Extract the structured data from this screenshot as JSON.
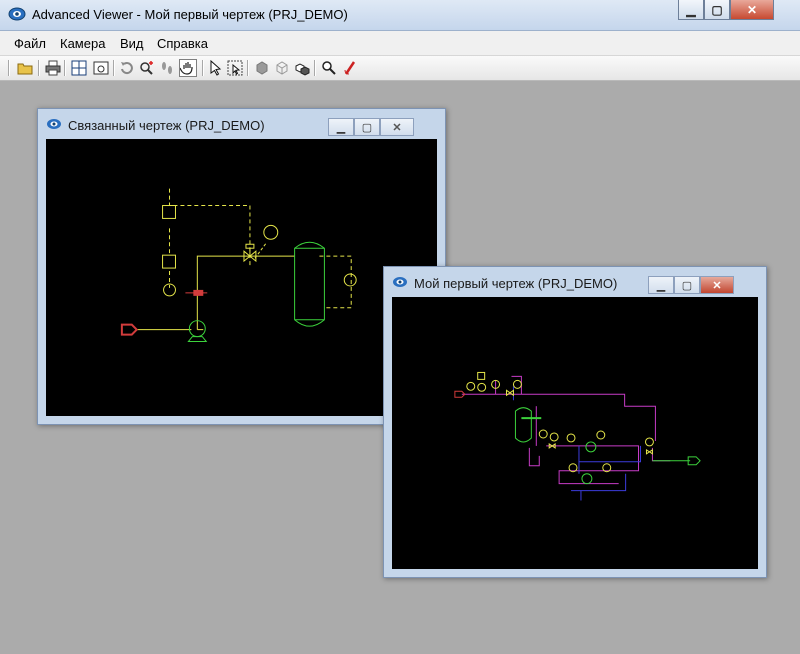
{
  "app": {
    "title": "Advanced Viewer - Мой первый чертеж (PRJ_DEMO)",
    "icon": "advanced-viewer-eye-icon"
  },
  "caption_buttons": {
    "minimize": "▁",
    "maximize": "▢",
    "close": "✕"
  },
  "menu": [
    "Файл",
    "Камера",
    "Вид",
    "Справка"
  ],
  "toolbar": [
    {
      "name": "open-folder-icon"
    },
    {
      "name": "print-icon"
    },
    {
      "name": "layout-grid-icon"
    },
    {
      "name": "preview-icon"
    },
    {
      "name": "rotate-icon"
    },
    {
      "name": "zoom-add-icon"
    },
    {
      "name": "footsteps-icon"
    },
    {
      "name": "pan-hand-icon",
      "selected": true
    },
    {
      "name": "select-arrow-icon"
    },
    {
      "name": "select-window-icon"
    },
    {
      "name": "cube-solid-icon"
    },
    {
      "name": "cube-wire-icon"
    },
    {
      "name": "cubes-icon"
    },
    {
      "name": "magnifier-icon"
    },
    {
      "name": "measure-icon"
    }
  ],
  "windows": {
    "linked": {
      "title": "Связанный чертеж (PRJ_DEMO)",
      "active": false
    },
    "main": {
      "title": "Мой первый чертеж (PRJ_DEMO)",
      "active": true
    }
  },
  "colors": {
    "drawing_background": "#000000",
    "yellow": "#e6e64a",
    "green": "#3cd23c",
    "red": "#d23c3c",
    "magenta": "#c83cc8",
    "blue": "#3c3cdc",
    "desktop": "#ababab"
  }
}
